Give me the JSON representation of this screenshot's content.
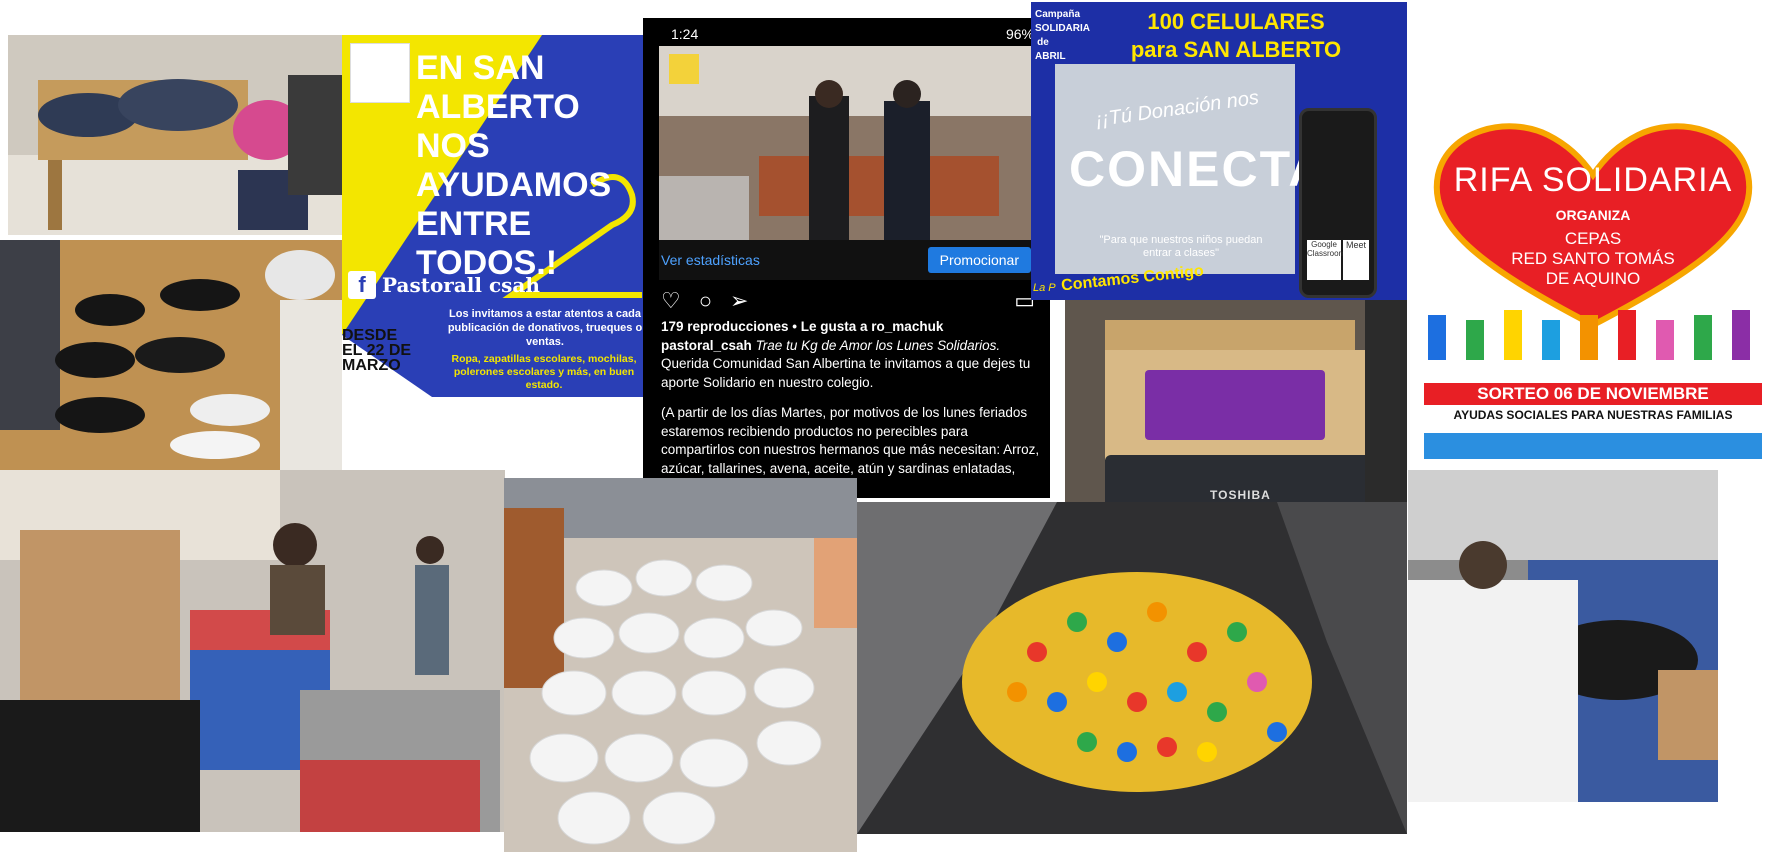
{
  "yellow_poster": {
    "title": "EN SAN ALBERTO NOS AYUDAMOS ENTRE TODOS.!",
    "facebook_handle": "Pastorall csah",
    "invite": "Los invitamos a estar atentos a cada publicación de donativos, trueques o ventas.",
    "date": "DESDE EL 22 DE MARZO",
    "items": "Ropa, zapatillas escolares, mochilas, polerones escolares y más, en buen estado."
  },
  "instagram_post": {
    "status_time": "1:24",
    "status_battery": "96%",
    "stats_link": "Ver estadísticas",
    "promote_button": "Promocionar",
    "likes": "179 reproducciones • Le gusta a ro_machuk",
    "author": "pastoral_csah",
    "caption_title": "Trae tu Kg de Amor los Lunes Solidarios.",
    "caption_body": "Querida Comunidad San Albertina te invitamos a que dejes tu aporte Solidario en nuestro colegio.",
    "caption_note": "(A partir de los días  Martes, por motivos de los lunes feriados estaremos recibiendo productos no perecibles para compartirlos con nuestros hermanos que más necesitan: Arroz, azúcar, tallarines, avena, aceite, atún y sardinas enlatadas, entre otros.)"
  },
  "campaign_poster": {
    "vertical_text": "Campaña SOLIDARIA de ABRIL",
    "title": "100 CELULARES para SAN ALBERTO",
    "donation": "¡¡Tú Donación nos",
    "conecta": "CONECTA",
    "quote": "\"Para que nuestros niños puedan entrar a clases\"",
    "contigo": "Contamos Contigo",
    "gc_label": "Google Classroom",
    "meet_label": "Meet",
    "bottom_fragment": "La P"
  },
  "laptop_photo": {
    "brand": "TOSHIBA"
  },
  "rifa_poster": {
    "title": "RIFA SOLIDARIA",
    "organiza": "ORGANIZA",
    "org_line1": "CEPAS",
    "org_line2": "RED SANTO TOMÁS",
    "org_line3": "DE AQUINO",
    "sorteo": "SORTEO 06 DE NOVIEMBRE",
    "ayudas": "AYUDAS SOCIALES PARA NUESTRAS FAMILIAS"
  },
  "colors": {
    "poster_blue": "#2a3fb6",
    "poster_yellow": "#f3e600",
    "campaign_blue": "#1d2fa6",
    "rifa_red": "#e81f25"
  }
}
